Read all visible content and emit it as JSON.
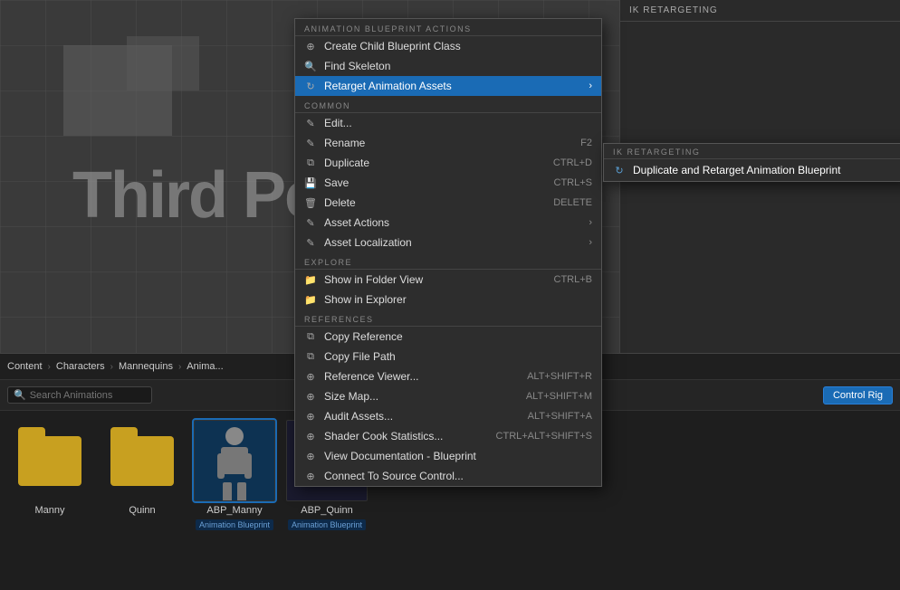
{
  "viewport": {
    "title": "Third Pers"
  },
  "ik_retargeting": {
    "header": "IK RETARGETING",
    "duplicate_label": "Duplicate and Retarget Animation Blueprint"
  },
  "breadcrumb": {
    "items": [
      "Content",
      "Characters",
      "Mannequins",
      "Anima..."
    ]
  },
  "content_browser": {
    "search_placeholder": "Search Animations",
    "buttons": [
      "Control Rig"
    ],
    "assets": [
      {
        "id": "manny",
        "type": "folder",
        "label": "Manny"
      },
      {
        "id": "quinn",
        "type": "folder",
        "label": "Quinn"
      },
      {
        "id": "abp_manny",
        "type": "blueprint",
        "label": "ABP_Manny",
        "sublabel": "Animation Blueprint",
        "selected": true
      },
      {
        "id": "abp_quinn",
        "type": "blueprint",
        "label": "ABP_Quinn",
        "sublabel": "Animation Blueprint",
        "selected": false
      }
    ]
  },
  "context_menu": {
    "sections": [
      {
        "header": "ANIMATION BLUEPRINT ACTIONS",
        "items": [
          {
            "id": "create_child",
            "icon": "⊕",
            "label": "Create Child Blueprint Class",
            "shortcut": "",
            "has_arrow": false
          },
          {
            "id": "find_skeleton",
            "icon": "🔍",
            "label": "Find Skeleton",
            "shortcut": "",
            "has_arrow": false
          },
          {
            "id": "retarget",
            "icon": "↻",
            "label": "Retarget Animation Assets",
            "shortcut": "",
            "has_arrow": true,
            "active": true
          }
        ]
      },
      {
        "header": "COMMON",
        "items": [
          {
            "id": "edit",
            "icon": "✎",
            "label": "Edit...",
            "shortcut": "",
            "has_arrow": false
          },
          {
            "id": "rename",
            "icon": "✎",
            "label": "Rename",
            "shortcut": "F2",
            "has_arrow": false
          },
          {
            "id": "duplicate",
            "icon": "⧉",
            "label": "Duplicate",
            "shortcut": "CTRL+D",
            "has_arrow": false
          },
          {
            "id": "save",
            "icon": "💾",
            "label": "Save",
            "shortcut": "CTRL+S",
            "has_arrow": false
          },
          {
            "id": "delete",
            "icon": "🗑",
            "label": "Delete",
            "shortcut": "DELETE",
            "has_arrow": false
          },
          {
            "id": "asset_actions",
            "icon": "✎",
            "label": "Asset Actions",
            "shortcut": "",
            "has_arrow": true
          },
          {
            "id": "asset_localization",
            "icon": "✎",
            "label": "Asset Localization",
            "shortcut": "",
            "has_arrow": true
          }
        ]
      },
      {
        "header": "EXPLORE",
        "items": [
          {
            "id": "show_folder",
            "icon": "📁",
            "label": "Show in Folder View",
            "shortcut": "CTRL+B",
            "has_arrow": false
          },
          {
            "id": "show_explorer",
            "icon": "📁",
            "label": "Show in Explorer",
            "shortcut": "",
            "has_arrow": false
          }
        ]
      },
      {
        "header": "REFERENCES",
        "items": [
          {
            "id": "copy_ref",
            "icon": "⧉",
            "label": "Copy Reference",
            "shortcut": "",
            "has_arrow": false
          },
          {
            "id": "copy_file",
            "icon": "⧉",
            "label": "Copy File Path",
            "shortcut": "",
            "has_arrow": false
          },
          {
            "id": "ref_viewer",
            "icon": "⊕",
            "label": "Reference Viewer...",
            "shortcut": "ALT+SHIFT+R",
            "has_arrow": false
          },
          {
            "id": "size_map",
            "icon": "⊕",
            "label": "Size Map...",
            "shortcut": "ALT+SHIFT+M",
            "has_arrow": false
          },
          {
            "id": "audit",
            "icon": "⊕",
            "label": "Audit Assets...",
            "shortcut": "ALT+SHIFT+A",
            "has_arrow": false
          },
          {
            "id": "shader_cook",
            "icon": "⊕",
            "label": "Shader Cook Statistics...",
            "shortcut": "CTRL+ALT+SHIFT+S",
            "has_arrow": false
          },
          {
            "id": "view_doc",
            "icon": "⊕",
            "label": "View Documentation - Blueprint",
            "shortcut": "",
            "has_arrow": false
          },
          {
            "id": "connect_source",
            "icon": "⊕",
            "label": "Connect To Source Control...",
            "shortcut": "",
            "has_arrow": false
          }
        ]
      }
    ]
  },
  "retarget_submenu": {
    "header": "IK RETARGETING",
    "items": [
      {
        "id": "duplicate_retarget",
        "icon": "↻",
        "label": "Duplicate and Retarget Animation Blueprint"
      }
    ]
  }
}
